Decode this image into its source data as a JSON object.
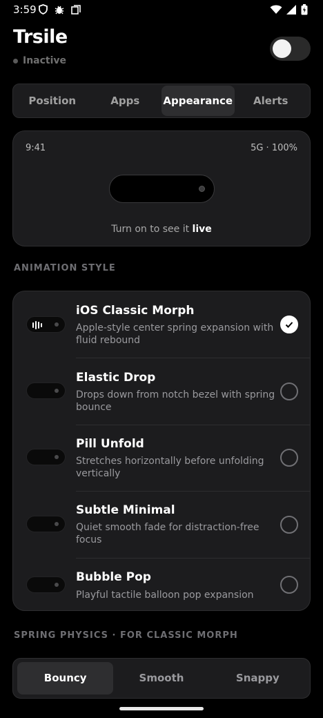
{
  "status_bar": {
    "time": "3:59",
    "icons_left": [
      "shield-icon",
      "bug-icon",
      "copy-icon"
    ],
    "icons_right": [
      "wifi-icon",
      "signal-icon",
      "battery-icon"
    ]
  },
  "header": {
    "title": "Trsile",
    "status": "Inactive",
    "toggle_on": false
  },
  "tabs": [
    {
      "label": "Position",
      "active": false
    },
    {
      "label": "Apps",
      "active": false
    },
    {
      "label": "Appearance",
      "active": true
    },
    {
      "label": "Alerts",
      "active": false
    }
  ],
  "preview": {
    "time": "9:41",
    "network": "5G · 100%",
    "hint_prefix": "Turn on to see it ",
    "hint_emphasis": "live"
  },
  "animation_section": {
    "label": "ANIMATION STYLE",
    "items": [
      {
        "title": "iOS Classic Morph",
        "description": "Apple-style center spring expansion with fluid rebound",
        "selected": true
      },
      {
        "title": "Elastic Drop",
        "description": "Drops down from notch bezel with spring bounce",
        "selected": false
      },
      {
        "title": "Pill Unfold",
        "description": "Stretches horizontally before unfolding vertically",
        "selected": false
      },
      {
        "title": "Subtle Minimal",
        "description": "Quiet smooth fade for distraction-free focus",
        "selected": false
      },
      {
        "title": "Bubble Pop",
        "description": "Playful tactile balloon pop expansion",
        "selected": false
      }
    ]
  },
  "spring_section": {
    "label": "SPRING PHYSICS · FOR CLASSIC MORPH",
    "options": [
      {
        "label": "Bouncy",
        "active": true
      },
      {
        "label": "Smooth",
        "active": false
      },
      {
        "label": "Snappy",
        "active": false
      }
    ]
  },
  "colors": {
    "background": "#000000",
    "card": "#1c1c1e",
    "accent": "#ffffff",
    "muted_text": "#9a9a9e"
  }
}
